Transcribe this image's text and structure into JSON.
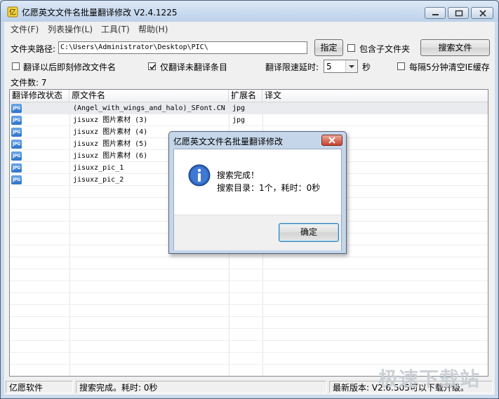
{
  "window": {
    "title": "亿愿英文文件名批量翻译修改 V2.4.1225",
    "icon": "app-icon"
  },
  "menu": [
    "文件(F)",
    "列表操作(L)",
    "工具(T)",
    "帮助(H)"
  ],
  "toolbar": {
    "folder_label": "文件夹路径:",
    "folder_value": "C:\\Users\\Administrator\\Desktop\\PIC\\",
    "specify_button": "指定",
    "include_subfolders_label": "包含子文件夹",
    "include_subfolders_checked": false,
    "search_button": "搜索文件"
  },
  "options": {
    "rename_after_translate_label": "翻译以后即刻修改文件名",
    "rename_after_translate_checked": false,
    "only_untranslated_label": "仅翻译未翻译条目",
    "only_untranslated_checked": true,
    "delay_label": "翻译限速延时:",
    "delay_value": "5",
    "delay_unit": "秒",
    "clear_cache_label": "每隔5分钟清空IE缓存",
    "clear_cache_checked": false
  },
  "file_count_label": "文件数: 7",
  "list": {
    "columns": [
      "翻译修改状态",
      "原文件名",
      "扩展名",
      "译文"
    ],
    "rows": [
      {
        "status_icon": "JPG",
        "name": "(Angel_with_wings_and_halo)_SFont.CN",
        "ext": "jpg",
        "translation": ""
      },
      {
        "status_icon": "JPG",
        "name": "jisuxz 图片素材 (3)",
        "ext": "jpg",
        "translation": ""
      },
      {
        "status_icon": "JPG",
        "name": "jisuxz 图片素材 (4)",
        "ext": "",
        "translation": ""
      },
      {
        "status_icon": "JPG",
        "name": "jisuxz 图片素材 (5)",
        "ext": "",
        "translation": ""
      },
      {
        "status_icon": "JPG",
        "name": "jisuxz 图片素材 (6)",
        "ext": "",
        "translation": ""
      },
      {
        "status_icon": "JPG",
        "name": "jisuxz_pic_1",
        "ext": "",
        "translation": ""
      },
      {
        "status_icon": "JPG",
        "name": "jisuxz_pic_2",
        "ext": "",
        "translation": ""
      }
    ]
  },
  "dialog": {
    "title": "亿愿英文文件名批量翻译修改",
    "message_line1": "搜索完成！",
    "message_line2": "搜索目录：1个，耗时：0秒",
    "ok_button": "确定"
  },
  "statusbar": {
    "app": "亿愿软件",
    "status": "搜索完成。耗时: 0秒",
    "version": "最新版本: V2.6.505可以下载升级。"
  },
  "watermark": "极速下载站",
  "colors": {
    "titlebar": "#bcd1ea",
    "selected_row": "#e9ebee",
    "dialog_close": "#c7412d",
    "info_icon": "#2b5fb4"
  }
}
